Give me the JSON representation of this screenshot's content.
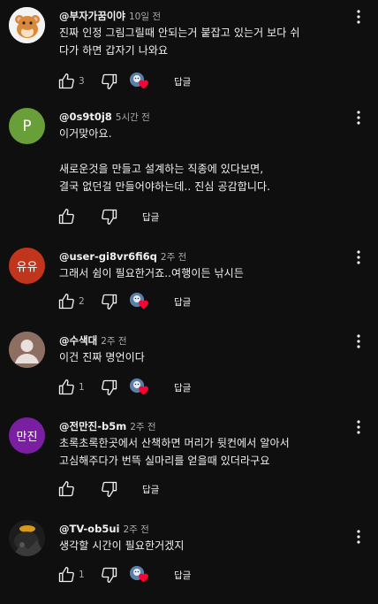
{
  "labels": {
    "reply": "답글"
  },
  "colors": {
    "background": "#0f0f0f",
    "heart": "#ff0033"
  },
  "comments": [
    {
      "author": "@부자가꿈이야",
      "time": "10일 전",
      "text": "진짜 인정 그림그릴때 안되는거 붙잡고 있는거 보다 쉬\n다가 하면 갑자기 나와요",
      "likes": "3",
      "avatar": {
        "kind": "hamster-image",
        "initials": "",
        "color": "#f3f3f3"
      },
      "creator_heart": true
    },
    {
      "author": "@0s9t0j8",
      "time": "5시간 전",
      "text": "이거맞아요.\n\n새로운것을 만들고 설계하는 직종에 있다보면,\n결국 없던걸 만들어야하는데.. 진심 공감합니다.",
      "likes": "",
      "avatar": {
        "kind": "initials",
        "initials": "P",
        "color": "#689f38"
      },
      "creator_heart": false
    },
    {
      "author": "@user-gi8vr6fi6q",
      "time": "2주 전",
      "text": "그래서 쉼이 필요한거죠..여행이든 낚시든",
      "likes": "2",
      "avatar": {
        "kind": "initials",
        "initials": "유유",
        "color": "#c1351d"
      },
      "creator_heart": true
    },
    {
      "author": "@수색대",
      "time": "2주 전",
      "text": "이건 진짜 명언이다",
      "likes": "1",
      "avatar": {
        "kind": "default-person",
        "initials": "",
        "color": "#8d6e63"
      },
      "creator_heart": true
    },
    {
      "author": "@전만진-b5m",
      "time": "2주 전",
      "text": "초록초록한곳에서 산책하면 머리가 뒷컨에서 알아서\n고심해주다가 번뜩 실마리를 얻을때 있더라구요",
      "likes": "",
      "avatar": {
        "kind": "initials",
        "initials": "만진",
        "color": "#7b1fa2"
      },
      "creator_heart": false
    },
    {
      "author": "@TV-ob5ui",
      "time": "2주 전",
      "text": "생각할 시간이 필요한거겠지",
      "likes": "1",
      "avatar": {
        "kind": "photo-image",
        "initials": "",
        "color": "#1c1c1c"
      },
      "creator_heart": true
    }
  ]
}
